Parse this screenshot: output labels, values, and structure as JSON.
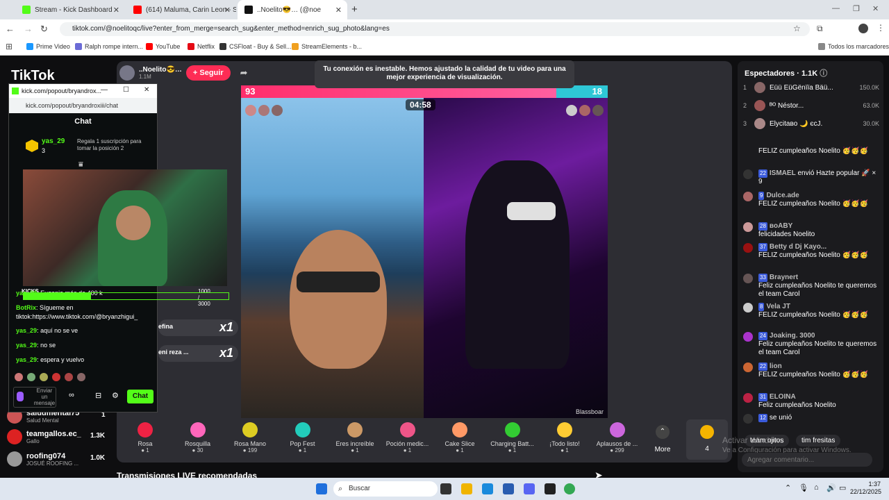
{
  "browser": {
    "tabs": [
      {
        "title": "Stream - Kick Dashboard",
        "color": "#53fc18"
      },
      {
        "title": "(614) Maluma, Carin Leon - Seg",
        "color": "#ff0000"
      },
      {
        "title": "..Noelito😎… (@noe",
        "color": "#111111"
      }
    ],
    "url": "tiktok.com/@noelitoqc/live?enter_from_merge=search_sug&enter_method=enrich_sug_photo&lang=es",
    "bookmarks": [
      "Prime Video",
      "Ralph rompe intern...",
      "YouTube",
      "Netflix",
      "CSFloat - Buy & Sell...",
      "StreamElements - b...",
      "Todos los marcadores"
    ]
  },
  "tiktok": {
    "logo": "TikTok",
    "host": {
      "name": "..Noelito😎…",
      "viewers": "1.1M",
      "follow_label": "+ Seguir"
    },
    "notice": "Tu conexión es inestable. Hemos ajustado la calidad de tu video para una mejor experiencia de visualización.",
    "score_left": "93",
    "score_right": "18",
    "score_left_share": 0.86,
    "timer": "04:58",
    "watermark": "Blassboar",
    "gifts": [
      {
        "name": "Rosa",
        "price": "1"
      },
      {
        "name": "Rosquilla",
        "price": "30"
      },
      {
        "name": "Rosa Mano",
        "price": "199"
      },
      {
        "name": "Pop Fest",
        "price": "1"
      },
      {
        "name": "Eres increíble",
        "price": "1"
      },
      {
        "name": "Poción medic...",
        "price": "1"
      },
      {
        "name": "Cake Slice",
        "price": "1"
      },
      {
        "name": "Charging Batt...",
        "price": "1"
      },
      {
        "name": "¡Todo listo!",
        "price": "1"
      },
      {
        "name": "Aplausos de ...",
        "price": "299"
      }
    ],
    "more_label": "More",
    "coins": "4",
    "recommended_title": "Transmisiones LIVE recomendadas",
    "combo": [
      {
        "name": "efina",
        "count": "x1"
      },
      {
        "name": "eni reza ...",
        "count": "x1"
      }
    ],
    "left_list": [
      {
        "name": "saludmental75",
        "sub": "Salud Mental",
        "count": "1"
      },
      {
        "name": "teamgallos.ec_",
        "sub": "Gallo",
        "count": "1.3K"
      },
      {
        "name": "roofing074",
        "sub": "JOSUÉ ROOFING ...",
        "count": "1.0K"
      }
    ]
  },
  "side": {
    "title": "Espectadores",
    "viewer_count": "1.1K",
    "top_viewers": [
      {
        "rank": "1",
        "name": "Eüü EüGënïïa Bäü...",
        "count": "150.0K"
      },
      {
        "rank": "2",
        "name": "ᴮᴼ Néstor...",
        "count": "63.0K"
      },
      {
        "rank": "3",
        "name": "Elycitaвo 🌙 єcJ.",
        "count": "30.0K"
      }
    ],
    "messages": [
      {
        "level": "",
        "user": "",
        "text": "FELIZ cumpleaños Noelito 🥳🥳🥳"
      },
      {
        "level": "22",
        "user": "ISMAEL",
        "text": "envió Hazte popular 🚀 × 9"
      },
      {
        "level": "9",
        "user": "Dulce.ade",
        "text": "FELIZ cumpleaños Noelito 🥳🥳🥳"
      },
      {
        "level": "28",
        "user": "вoABY",
        "text": "felicidades Noelito"
      },
      {
        "level": "37",
        "user": "Betty d Dj Kayo...",
        "text": "FELIZ cumpleaños Noelito 🥳🥳🥳"
      },
      {
        "level": "33",
        "user": "Braynert",
        "text": "Feliz cumpleaños Noelito te queremos el team Carol"
      },
      {
        "level": "8",
        "user": "Vela JT",
        "text": "FELIZ cumpleaños Noelito 🥳🥳🥳"
      },
      {
        "level": "24",
        "user": "Joaking. 3000",
        "text": "Feliz cumpleaños Noelito te queremos el team Carol"
      },
      {
        "level": "22",
        "user": "lion",
        "text": "FELIZ cumpleaños Noelito 🥳🥳🥳"
      },
      {
        "level": "31",
        "user": "ELOINA",
        "text": "Feliz cumpleaños Noelito"
      },
      {
        "level": "12",
        "user": "",
        "text": "se unió"
      }
    ],
    "chips": [
      "team ojitos",
      "tim fresitas"
    ],
    "comment_placeholder": "Agregar comentario...",
    "activate_title": "Activar Windows",
    "activate_sub": "Ve a Configuración para activar Windows."
  },
  "kick": {
    "window_title": "kick.com/popout/bryandrox...",
    "url": "kick.com/popout/bryandroxiii/chat",
    "chat_title": "Chat",
    "top_user": "yas_29",
    "top_user_count": "3",
    "gift_cta": "Regala 1 suscripción para tomar la posición 2",
    "goal_label": "KICKS",
    "goal_progress": "1000 / 3000",
    "goal_fraction": 0.33,
    "messages": [
      {
        "user": "yas_29",
        "text": "Eugenia más de 400 k"
      },
      {
        "user": "BotRix",
        "text": "Sígueme en tiktok:https://www.tiktok.com/@bryanzhigui_"
      },
      {
        "user": "yas_29",
        "text": "aquí no se ve"
      },
      {
        "user": "yas_29",
        "text": "no se"
      },
      {
        "user": "yas_29",
        "text": "espera y vuelvo"
      }
    ],
    "input_placeholder": "Enviar un mensaje",
    "send_label": "Chat"
  },
  "taskbar": {
    "search": "Buscar",
    "time": "1:37",
    "date": "22/12/2025"
  }
}
